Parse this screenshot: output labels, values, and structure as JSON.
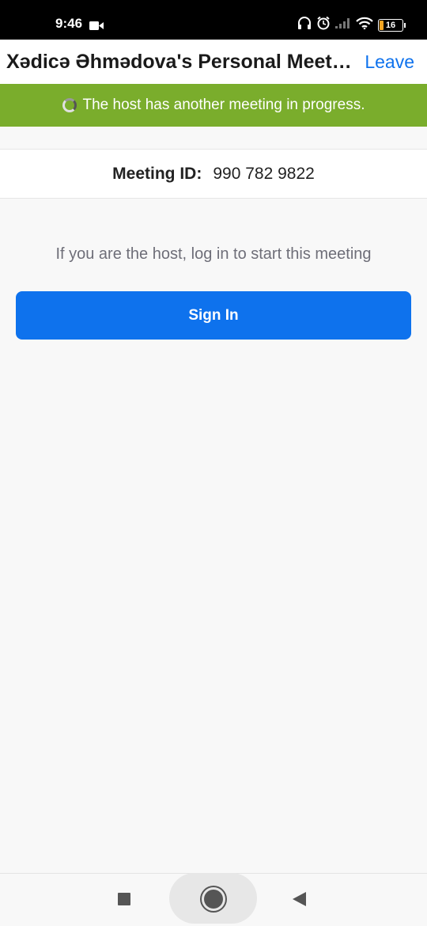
{
  "status_bar": {
    "time": "9:46",
    "battery_level": "16",
    "icons": [
      "video-camera-icon",
      "headphones-icon",
      "alarm-icon",
      "signal-icon",
      "wifi-icon",
      "battery-icon"
    ]
  },
  "header": {
    "title": "Xədicə Əhmədova's Personal Meeting Room",
    "leave_label": "Leave"
  },
  "banner": {
    "text": "The host has another meeting in progress.",
    "color": "#7aad2c"
  },
  "meeting": {
    "id_label": "Meeting ID:",
    "id_value": "990 782 9822"
  },
  "main": {
    "hint": "If you are the host, log in to start this meeting",
    "signin_label": "Sign In",
    "accent_color": "#0e72ed"
  },
  "nav_bar": {
    "icons": [
      "recents-square-icon",
      "home-circle-icon",
      "back-triangle-icon"
    ]
  }
}
